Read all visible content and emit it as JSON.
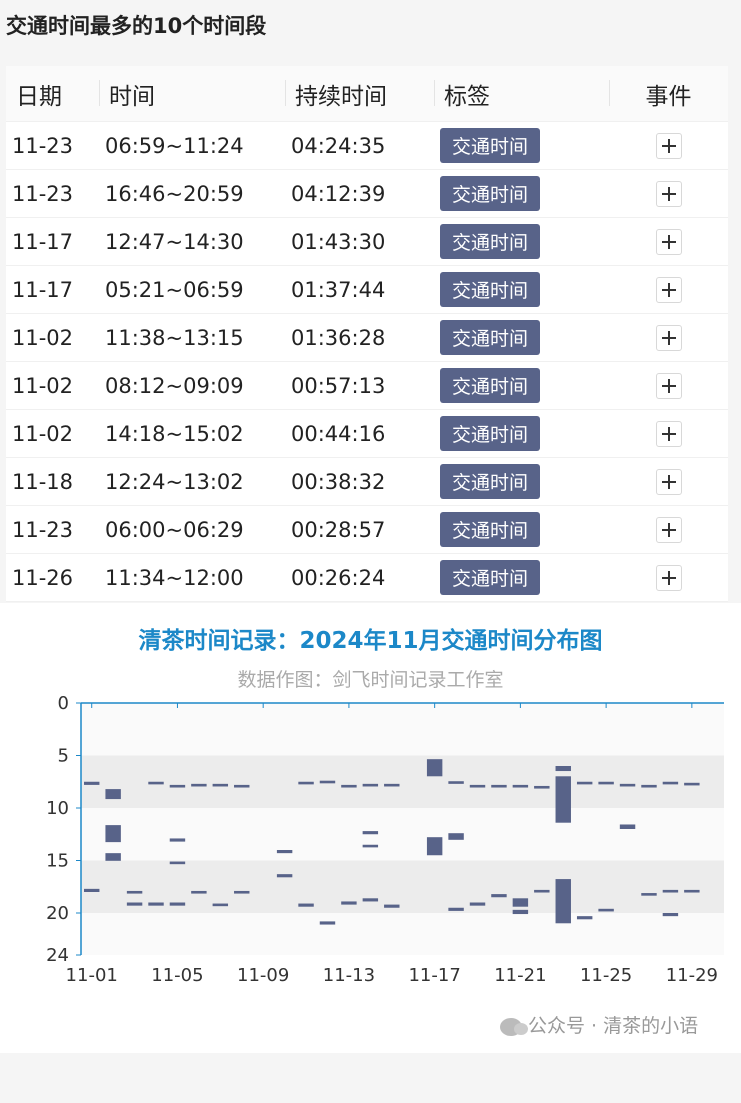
{
  "section": {
    "title": "交通时间最多的10个时间段"
  },
  "table": {
    "headers": [
      "日期",
      "时间",
      "持续时间",
      "标签",
      "事件"
    ],
    "rows": [
      {
        "date": "11-23",
        "time": "06:59~11:24",
        "duration": "04:24:35",
        "tag": "交通时间"
      },
      {
        "date": "11-23",
        "time": "16:46~20:59",
        "duration": "04:12:39",
        "tag": "交通时间"
      },
      {
        "date": "11-17",
        "time": "12:47~14:30",
        "duration": "01:43:30",
        "tag": "交通时间"
      },
      {
        "date": "11-17",
        "time": "05:21~06:59",
        "duration": "01:37:44",
        "tag": "交通时间"
      },
      {
        "date": "11-02",
        "time": "11:38~13:15",
        "duration": "01:36:28",
        "tag": "交通时间"
      },
      {
        "date": "11-02",
        "time": "08:12~09:09",
        "duration": "00:57:13",
        "tag": "交通时间"
      },
      {
        "date": "11-02",
        "time": "14:18~15:02",
        "duration": "00:44:16",
        "tag": "交通时间"
      },
      {
        "date": "11-18",
        "time": "12:24~13:02",
        "duration": "00:38:32",
        "tag": "交通时间"
      },
      {
        "date": "11-23",
        "time": "06:00~06:29",
        "duration": "00:28:57",
        "tag": "交通时间"
      },
      {
        "date": "11-26",
        "time": "11:34~12:00",
        "duration": "00:26:24",
        "tag": "交通时间"
      }
    ]
  },
  "chart_data": {
    "type": "bar",
    "title": "清茶时间记录：2024年11月交通时间分布图",
    "subtitle": "数据作图：剑飞时间记录工作室",
    "xlabel": "",
    "ylabel": "",
    "x_range": [
      1,
      30
    ],
    "ylim": [
      0,
      24
    ],
    "y_ticks": [
      0,
      5,
      10,
      15,
      20,
      24
    ],
    "x_tick_labels": [
      "11-01",
      "11-05",
      "11-09",
      "11-13",
      "11-17",
      "11-21",
      "11-25",
      "11-29"
    ],
    "x_tick_days": [
      1,
      5,
      9,
      13,
      17,
      21,
      25,
      29
    ],
    "bands": [
      [
        5,
        10
      ],
      [
        15,
        20
      ]
    ],
    "bar_color": "#586389",
    "segments": [
      {
        "day": 1,
        "start": 7.5,
        "end": 7.8
      },
      {
        "day": 1,
        "start": 17.7,
        "end": 18.0
      },
      {
        "day": 2,
        "start": 8.2,
        "end": 9.15
      },
      {
        "day": 2,
        "start": 11.63,
        "end": 13.25
      },
      {
        "day": 2,
        "start": 14.3,
        "end": 15.03
      },
      {
        "day": 3,
        "start": 17.9,
        "end": 18.15
      },
      {
        "day": 3,
        "start": 19.0,
        "end": 19.3
      },
      {
        "day": 4,
        "start": 7.5,
        "end": 7.75
      },
      {
        "day": 4,
        "start": 19.0,
        "end": 19.3
      },
      {
        "day": 5,
        "start": 7.8,
        "end": 8.05
      },
      {
        "day": 5,
        "start": 12.9,
        "end": 13.2
      },
      {
        "day": 5,
        "start": 15.1,
        "end": 15.35
      },
      {
        "day": 5,
        "start": 19.0,
        "end": 19.3
      },
      {
        "day": 6,
        "start": 7.7,
        "end": 7.95
      },
      {
        "day": 6,
        "start": 17.9,
        "end": 18.15
      },
      {
        "day": 7,
        "start": 7.7,
        "end": 7.95
      },
      {
        "day": 7,
        "start": 19.1,
        "end": 19.35
      },
      {
        "day": 8,
        "start": 7.8,
        "end": 8.05
      },
      {
        "day": 8,
        "start": 17.9,
        "end": 18.15
      },
      {
        "day": 10,
        "start": 14.0,
        "end": 14.3
      },
      {
        "day": 10,
        "start": 16.3,
        "end": 16.6
      },
      {
        "day": 11,
        "start": 7.5,
        "end": 7.75
      },
      {
        "day": 11,
        "start": 19.1,
        "end": 19.4
      },
      {
        "day": 12,
        "start": 7.4,
        "end": 7.65
      },
      {
        "day": 12,
        "start": 20.8,
        "end": 21.1
      },
      {
        "day": 13,
        "start": 7.8,
        "end": 8.05
      },
      {
        "day": 13,
        "start": 18.9,
        "end": 19.2
      },
      {
        "day": 14,
        "start": 7.7,
        "end": 7.95
      },
      {
        "day": 14,
        "start": 12.2,
        "end": 12.5
      },
      {
        "day": 14,
        "start": 13.5,
        "end": 13.75
      },
      {
        "day": 14,
        "start": 18.6,
        "end": 18.9
      },
      {
        "day": 15,
        "start": 7.7,
        "end": 7.95
      },
      {
        "day": 15,
        "start": 19.2,
        "end": 19.5
      },
      {
        "day": 17,
        "start": 5.35,
        "end": 6.98
      },
      {
        "day": 17,
        "start": 12.78,
        "end": 14.5
      },
      {
        "day": 18,
        "start": 7.45,
        "end": 7.7
      },
      {
        "day": 18,
        "start": 12.4,
        "end": 13.03
      },
      {
        "day": 18,
        "start": 19.5,
        "end": 19.8
      },
      {
        "day": 19,
        "start": 7.8,
        "end": 8.05
      },
      {
        "day": 19,
        "start": 19.0,
        "end": 19.3
      },
      {
        "day": 20,
        "start": 7.8,
        "end": 8.05
      },
      {
        "day": 20,
        "start": 18.2,
        "end": 18.5
      },
      {
        "day": 21,
        "start": 7.8,
        "end": 8.05
      },
      {
        "day": 21,
        "start": 18.6,
        "end": 19.4
      },
      {
        "day": 21,
        "start": 19.7,
        "end": 20.1
      },
      {
        "day": 22,
        "start": 7.9,
        "end": 8.15
      },
      {
        "day": 22,
        "start": 17.8,
        "end": 18.05
      },
      {
        "day": 23,
        "start": 6.0,
        "end": 6.48
      },
      {
        "day": 23,
        "start": 6.98,
        "end": 11.4
      },
      {
        "day": 23,
        "start": 16.77,
        "end": 20.98
      },
      {
        "day": 24,
        "start": 7.5,
        "end": 7.75
      },
      {
        "day": 24,
        "start": 20.3,
        "end": 20.6
      },
      {
        "day": 25,
        "start": 7.5,
        "end": 7.75
      },
      {
        "day": 25,
        "start": 19.6,
        "end": 19.85
      },
      {
        "day": 26,
        "start": 7.7,
        "end": 7.95
      },
      {
        "day": 26,
        "start": 11.57,
        "end": 12.0
      },
      {
        "day": 27,
        "start": 7.8,
        "end": 8.05
      },
      {
        "day": 27,
        "start": 18.1,
        "end": 18.35
      },
      {
        "day": 28,
        "start": 7.5,
        "end": 7.75
      },
      {
        "day": 28,
        "start": 17.8,
        "end": 18.05
      },
      {
        "day": 28,
        "start": 20.0,
        "end": 20.3
      },
      {
        "day": 29,
        "start": 7.6,
        "end": 7.85
      },
      {
        "day": 29,
        "start": 17.8,
        "end": 18.05
      }
    ]
  },
  "watermark": {
    "text": "公众号 · 清茶的小语",
    "icon": "wechat-icon"
  }
}
